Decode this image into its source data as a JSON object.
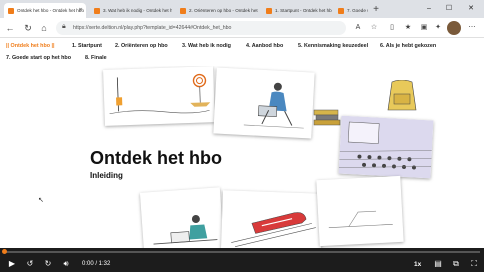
{
  "browser": {
    "tabs": [
      {
        "title": "Ontdek het hbo - Ontdek het hbo",
        "active": true
      },
      {
        "title": "3. Wat heb ik nodig - Ontdek het hbo",
        "active": false
      },
      {
        "title": "2. Oriënteren op hbo - Ontdek het hbo",
        "active": false
      },
      {
        "title": "1. Startpunt - Ontdek het hbo",
        "active": false
      },
      {
        "title": "7. Goede start op het hbo - Ontdek",
        "active": false
      }
    ],
    "url": "https://xerte.deltion.nl/play.php?template_id=42644#Ontdek_het_hbo"
  },
  "course_nav": {
    "items": [
      "|| Ontdek het hbo ||",
      "1. Startpunt",
      "2. Oriënteren op hbo",
      "3. Wat heb ik nodig",
      "4. Aanbod hbo",
      "5. Kennismaking keuzedeel",
      "6. Als je hebt gekozen",
      "7. Goede start op het hbo",
      "8. Finale"
    ]
  },
  "main": {
    "title": "Ontdek het hbo",
    "subtitle": "Inleiding"
  },
  "player": {
    "time": "0:00 / 1:32",
    "speed": "1x",
    "progress": 0
  },
  "colors": {
    "accent": "#f07d1a",
    "player_bg": "#1c1c1c"
  },
  "icons": [
    "play-icon",
    "rewind-10-icon",
    "forward-10-icon",
    "volume-icon",
    "captions-icon",
    "pip-icon",
    "fullscreen-icon"
  ]
}
